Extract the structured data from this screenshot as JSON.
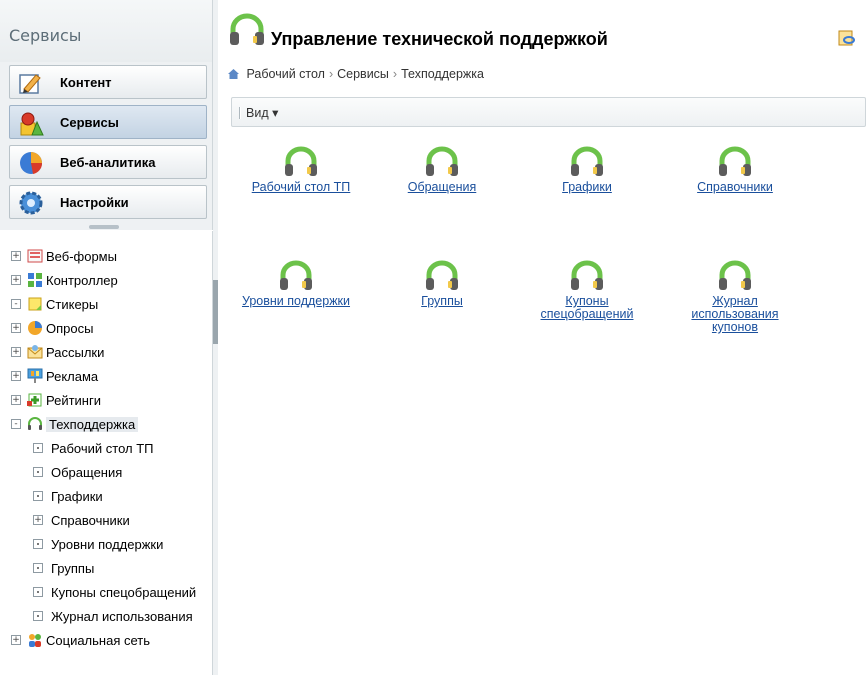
{
  "sidebar": {
    "title": "Сервисы",
    "buttons": [
      {
        "label": "Контент",
        "icon": "content-icon"
      },
      {
        "label": "Сервисы",
        "icon": "services-icon",
        "active": true
      },
      {
        "label": "Веб-аналитика",
        "icon": "analytics-icon"
      },
      {
        "label": "Настройки",
        "icon": "settings-icon"
      }
    ],
    "tree": [
      {
        "label": "Веб-формы",
        "toggle": "+",
        "icon": "webforms-icon"
      },
      {
        "label": "Контроллер",
        "toggle": "+",
        "icon": "controller-icon"
      },
      {
        "label": "Стикеры",
        "toggle": "-",
        "icon": "stickers-icon"
      },
      {
        "label": "Опросы",
        "toggle": "+",
        "icon": "polls-icon"
      },
      {
        "label": "Рассылки",
        "toggle": "+",
        "icon": "mailing-icon"
      },
      {
        "label": "Реклама",
        "toggle": "+",
        "icon": "advertising-icon"
      },
      {
        "label": "Рейтинги",
        "toggle": "+",
        "icon": "ratings-icon"
      },
      {
        "label": "Техподдержка",
        "toggle": "-",
        "icon": "headset-icon",
        "selected": true
      },
      {
        "label": "Рабочий стол ТП",
        "child": true,
        "toggle": "dot"
      },
      {
        "label": "Обращения",
        "child": true,
        "toggle": "dot"
      },
      {
        "label": "Графики",
        "child": true,
        "toggle": "dot"
      },
      {
        "label": "Справочники",
        "child": true,
        "toggle": "+"
      },
      {
        "label": "Уровни поддержки",
        "child": true,
        "toggle": "dot"
      },
      {
        "label": "Группы",
        "child": true,
        "toggle": "dot"
      },
      {
        "label": "Купоны спецобращений",
        "child": true,
        "toggle": "dot"
      },
      {
        "label": "Журнал использования",
        "child": true,
        "toggle": "dot"
      },
      {
        "label": "Социальная сеть",
        "toggle": "+",
        "icon": "social-network-icon"
      }
    ]
  },
  "main": {
    "title": "Управление технической поддержкой",
    "breadcrumb": [
      "Рабочий стол",
      "Сервисы",
      "Техподдержка"
    ],
    "toolbar": {
      "view_label": "Вид ▾"
    },
    "tiles": [
      {
        "label": "Рабочий стол ТП"
      },
      {
        "label": "Обращения"
      },
      {
        "label": "Графики"
      },
      {
        "label": "Справочники"
      },
      {
        "label": "Уровни поддержки"
      },
      {
        "label": "Группы"
      },
      {
        "label": "Купоны спецобращений"
      },
      {
        "label": "Журнал использования купонов"
      }
    ]
  }
}
